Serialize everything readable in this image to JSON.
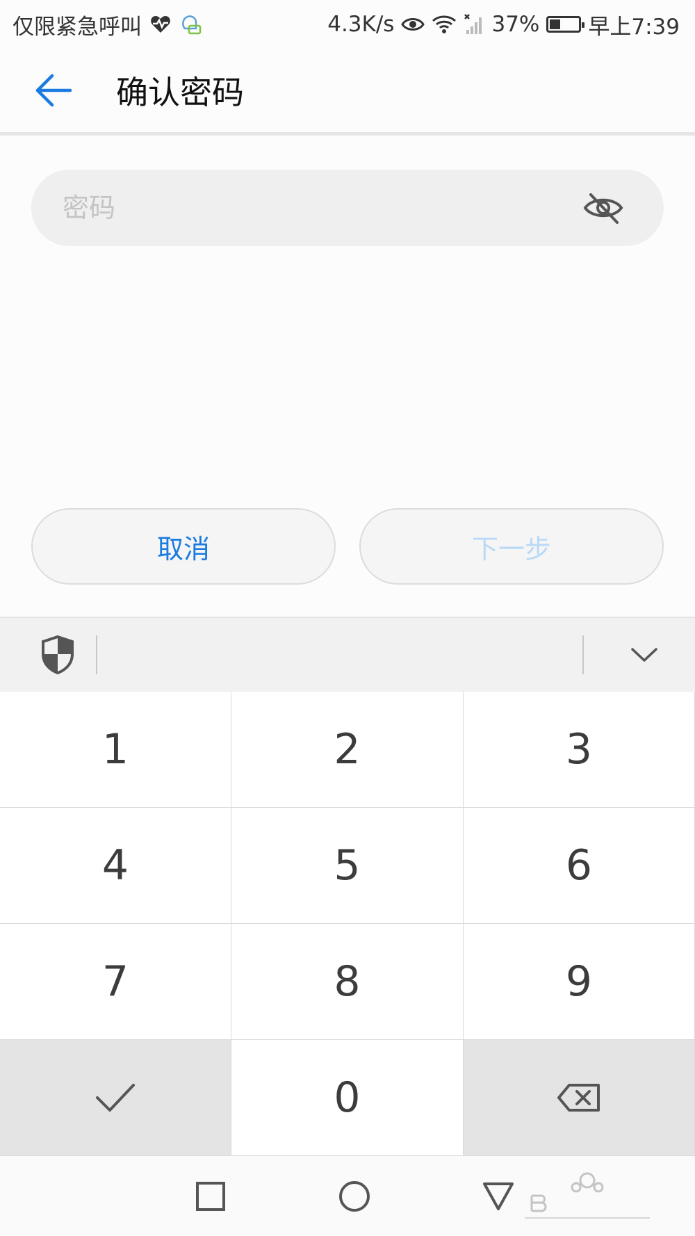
{
  "status_bar": {
    "carrier_text": "仅限紧急呼叫",
    "net_speed": "4.3K/s",
    "battery_percent": "37%",
    "battery_level": 0.37,
    "time": "早上7:39",
    "icons": [
      "heart-pulse-icon",
      "chat-bubble-icon",
      "eye-icon",
      "wifi-icon",
      "no-signal-icon",
      "battery-icon"
    ]
  },
  "header": {
    "title": "确认密码",
    "back_icon": "arrow-left-icon"
  },
  "password": {
    "placeholder": "密码",
    "value": "",
    "visibility_icon": "eye-off-icon"
  },
  "actions": {
    "cancel_label": "取消",
    "next_label": "下一步"
  },
  "keyboard": {
    "toolbar_icons": [
      "shield-icon",
      "chevron-down-icon"
    ],
    "keys": [
      "1",
      "2",
      "3",
      "4",
      "5",
      "6",
      "7",
      "8",
      "9",
      "",
      "0",
      ""
    ],
    "confirm_icon": "check-icon",
    "delete_icon": "backspace-icon"
  },
  "nav_bar": {
    "icons": [
      "square-icon",
      "circle-icon",
      "triangle-icon"
    ]
  },
  "colors": {
    "accent": "#1a7be0",
    "disabled_accent": "#b9d9f6",
    "field_bg": "#efefef"
  }
}
